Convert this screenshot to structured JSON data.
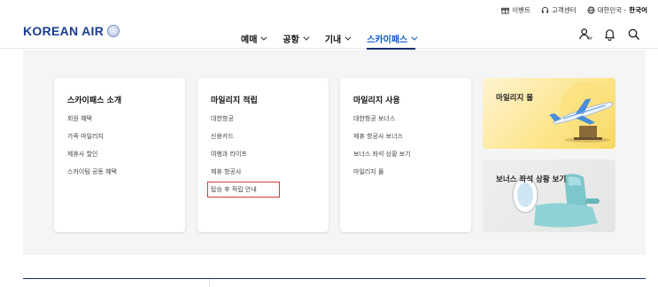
{
  "utility": {
    "event": "이벤트",
    "support": "고객센터",
    "language_prefix": "대한민국 -",
    "language_current": "한국어"
  },
  "header": {
    "logo": "KOREAN AIR",
    "nav": [
      {
        "label": "예매"
      },
      {
        "label": "공항"
      },
      {
        "label": "기내"
      },
      {
        "label": "스카이패스",
        "active": true
      }
    ],
    "icons": [
      "my-icon",
      "bell-icon",
      "search-icon"
    ]
  },
  "mega_menu": {
    "columns": [
      {
        "title": "스카이패스 소개",
        "links": [
          "회원 혜택",
          "가족 마일리지",
          "제휴사 할인",
          "스카이팀 공동 혜택"
        ]
      },
      {
        "title": "마일리지 적립",
        "links": [
          "대한항공",
          "신용카드",
          "여행과 라이프",
          "제휴 항공사",
          "탑승 후 적립 안내"
        ]
      },
      {
        "title": "마일리지 사용",
        "links": [
          "대한항공 보너스",
          "제휴 항공사 보너스",
          "보너스 좌석 상황 보기",
          "마일리지 몰"
        ]
      }
    ],
    "promos": [
      {
        "label": "마일리지 몰"
      },
      {
        "label": "보너스 좌석 상황 보기"
      }
    ]
  },
  "colors": {
    "brand_blue": "#1a3d8f",
    "active_nav": "#0a58c5",
    "highlight_box": "#d63b3b"
  }
}
